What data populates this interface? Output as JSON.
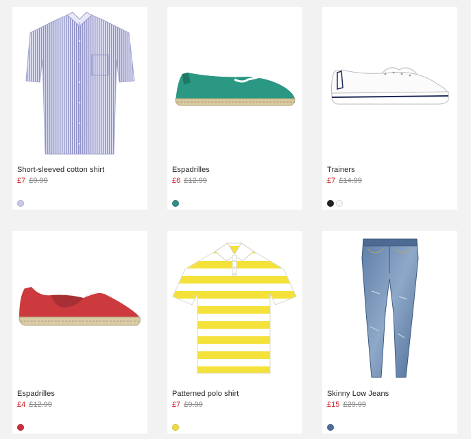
{
  "products": [
    {
      "name": "Short-sleeved cotton shirt",
      "price_now": "£7",
      "price_was": "£9.99",
      "image": "short-sleeved-shirt-image",
      "swatches": [
        {
          "name": "lavender-swatch",
          "color": "#c8c8ea"
        }
      ]
    },
    {
      "name": "Espadrilles",
      "price_now": "£6",
      "price_was": "£12.99",
      "image": "green-espadrille-image",
      "swatches": [
        {
          "name": "teal-swatch",
          "color": "#2f8f86"
        }
      ]
    },
    {
      "name": "Trainers",
      "price_now": "£7",
      "price_was": "£14.99",
      "image": "white-trainer-image",
      "swatches": [
        {
          "name": "black-swatch",
          "color": "#222222"
        },
        {
          "name": "white-swatch",
          "color": "#f7f7f7"
        }
      ]
    },
    {
      "name": "Espadrilles",
      "price_now": "£4",
      "price_was": "£12.99",
      "image": "red-espadrille-image",
      "swatches": [
        {
          "name": "red-swatch",
          "color": "#c8313a"
        }
      ]
    },
    {
      "name": "Patterned polo shirt",
      "price_now": "£7",
      "price_was": "£9.99",
      "image": "striped-polo-image",
      "swatches": [
        {
          "name": "yellow-swatch",
          "color": "#eedd40"
        }
      ]
    },
    {
      "name": "Skinny Low Jeans",
      "price_now": "£15",
      "price_was": "£29.99",
      "image": "skinny-jeans-image",
      "swatches": [
        {
          "name": "denim-swatch",
          "color": "#4d6e96"
        }
      ]
    }
  ]
}
